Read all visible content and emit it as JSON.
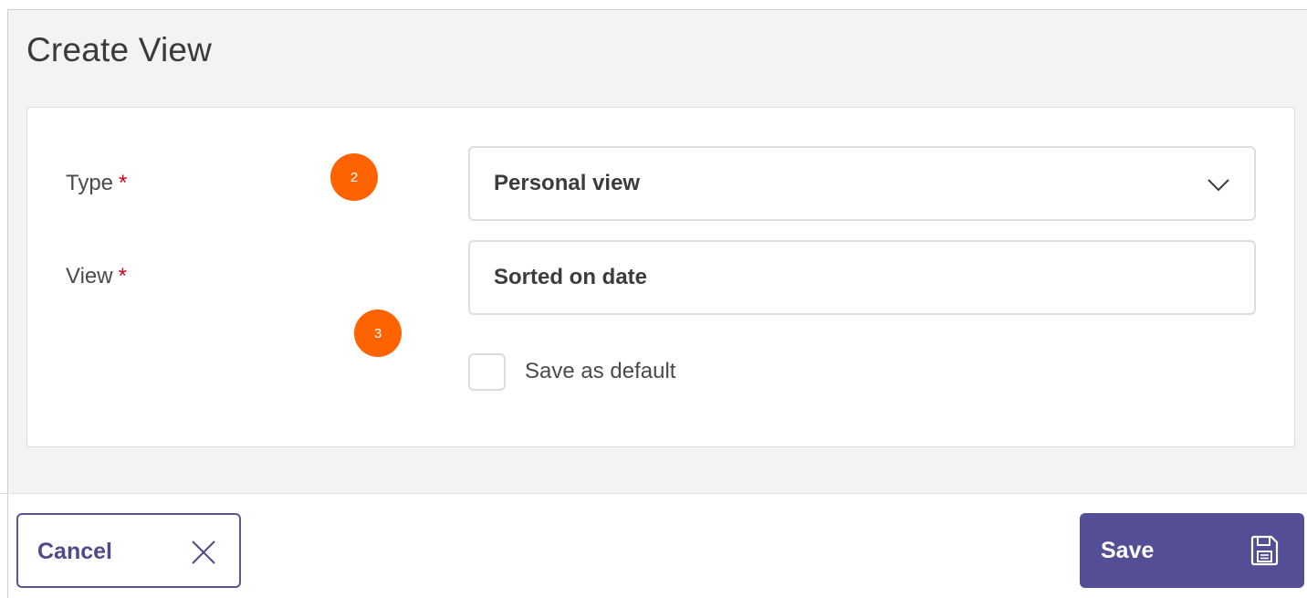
{
  "dialog": {
    "title": "Create View"
  },
  "form": {
    "type_field": {
      "label": "Type",
      "required_mark": "*",
      "value": "Personal view"
    },
    "view_field": {
      "label": "View",
      "required_mark": "*",
      "value": "Sorted on date"
    },
    "default_checkbox": {
      "label": "Save as default",
      "checked": false
    }
  },
  "callouts": [
    {
      "number": "2"
    },
    {
      "number": "3"
    }
  ],
  "footer": {
    "cancel_label": "Cancel",
    "save_label": "Save"
  },
  "colors": {
    "accent": "#534e96",
    "callout": "#ff6300",
    "required": "#d0021b"
  },
  "icons": {
    "select": "chevron-down-icon",
    "cancel": "close-icon",
    "save": "floppy-disk-icon"
  }
}
